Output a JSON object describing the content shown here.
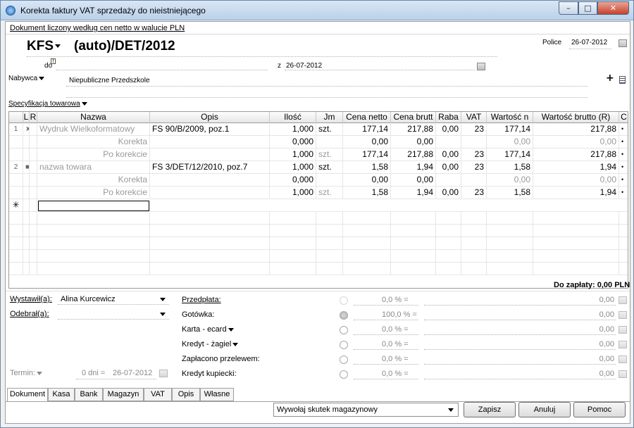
{
  "window": {
    "title": "Korekta faktury VAT sprzedaży do nieistniejącego",
    "minimize": "–",
    "maximize": "□",
    "close": "✕"
  },
  "header": {
    "doc_link": "Dokument liczony według cen netto w walucie PLN",
    "doc_type": "KFS",
    "doc_number": "(auto)/DET/2012",
    "place_label": "Police",
    "place_date": "26-07-2012",
    "do_label": "do",
    "z_label": "z",
    "z_date": "26-07-2012",
    "buyer_label": "Nabywca",
    "buyer_name": "Niepubliczne Przedszkole",
    "plus": "+",
    "spec_label": "Specyfikacja towarowa"
  },
  "grid": {
    "columns": [
      "L",
      "R",
      "Nazwa",
      "Opis",
      "Ilość",
      "Jm",
      "Cena netto",
      "Cena brutt",
      "Raba",
      "VAT",
      "Wartość n",
      "Wartość brutto (R)",
      "C"
    ],
    "rows": [
      {
        "lp": "1",
        "mark": "➤",
        "nazwa": "Wydruk Wielkoformatowy",
        "opis": "FS 90/B/2009, poz.1",
        "ilosc": "1,000",
        "jm": "szt.",
        "cn": "177,14",
        "cb": "217,88",
        "rab": "0,00",
        "vat": "23",
        "wn": "177,14",
        "wb": "217,88",
        "c": "•"
      },
      {
        "lp": "",
        "mark": "",
        "nazwa": "Korekta",
        "opis": "",
        "ilosc": "0,000",
        "jm": "",
        "cn": "0,00",
        "cb": "0,00",
        "rab": "",
        "vat": "",
        "wn": "0,00",
        "wb": "0,00",
        "c": "•"
      },
      {
        "lp": "",
        "mark": "",
        "nazwa": "Po korekcie",
        "opis": "",
        "ilosc": "1,000",
        "jm": "szt.",
        "cn": "177,14",
        "cb": "217,88",
        "rab": "0,00",
        "vat": "23",
        "wn": "177,14",
        "wb": "217,88",
        "c": "•"
      },
      {
        "lp": "2",
        "mark": "■",
        "nazwa": "nazwa towara",
        "opis": "FS 3/DET/12/2010, poz.7",
        "ilosc": "1,000",
        "jm": "szt.",
        "cn": "1,58",
        "cb": "1,94",
        "rab": "0,00",
        "vat": "23",
        "wn": "1,58",
        "wb": "1,94",
        "c": "•"
      },
      {
        "lp": "",
        "mark": "",
        "nazwa": "Korekta",
        "opis": "",
        "ilosc": "0,000",
        "jm": "",
        "cn": "0,00",
        "cb": "0,00",
        "rab": "",
        "vat": "",
        "wn": "0,00",
        "wb": "0,00",
        "c": "•"
      },
      {
        "lp": "",
        "mark": "",
        "nazwa": "Po korekcie",
        "opis": "",
        "ilosc": "1,000",
        "jm": "szt.",
        "cn": "1,58",
        "cb": "1,94",
        "rab": "0,00",
        "vat": "23",
        "wn": "1,58",
        "wb": "1,94",
        "c": "•"
      }
    ],
    "new_row_marker": "✳"
  },
  "summary": {
    "to_pay": "Do zapłaty: 0,00 PLN"
  },
  "bottom": {
    "issued_label": "Wystawił(a):",
    "issued_value": "Alina Kurcewicz",
    "received_label": "Odebrał(a):",
    "term_label": "Termin:",
    "term_days": "0 dni =",
    "term_date": "26-07-2012",
    "payments": [
      {
        "label": "Przedpłata:",
        "pct": "0,0 % =",
        "amt": "0,00"
      },
      {
        "label": "Gotówka:",
        "pct": "100,0 % =",
        "amt": "0,00"
      },
      {
        "label": "Karta - ecard",
        "pct": "0,0 % =",
        "amt": "0,00"
      },
      {
        "label": "Kredyt - żagiel",
        "pct": "0,0 % =",
        "amt": "0,00"
      },
      {
        "label": "Zapłacono przelewem:",
        "pct": "0,0 % =",
        "amt": "0,00"
      },
      {
        "label": "Kredyt kupiecki:",
        "pct": "0,0 % =",
        "amt": "0,00"
      }
    ]
  },
  "tabs": [
    "Dokument",
    "Kasa",
    "Bank",
    "Magazyn",
    "VAT",
    "Opis",
    "Własne"
  ],
  "footer": {
    "warehouse_action": "Wywołaj skutek magazynowy",
    "save": "Zapisz",
    "cancel": "Anuluj",
    "help": "Pomoc"
  }
}
